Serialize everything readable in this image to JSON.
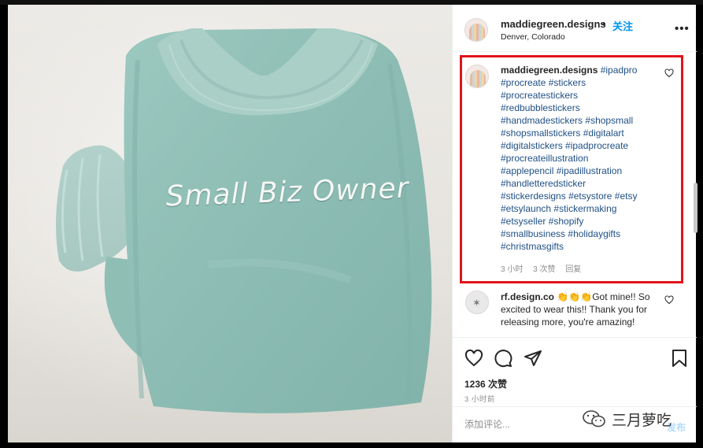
{
  "post": {
    "image_text": "Small Biz Owner",
    "colors": {
      "sweater": "#8fbeb5",
      "highlight_border": "#e1131b",
      "link": "#1f4f85",
      "follow": "#0095f6"
    }
  },
  "header": {
    "username": "maddiegreen.designs",
    "dot": "•",
    "follow_label": "关注",
    "location": "Denver, Colorado",
    "more_icon": "more-horizontal-icon"
  },
  "caption": {
    "username": "maddiegreen.designs",
    "hashtags": [
      "#ipadpro",
      "#procreate",
      "#stickers",
      "#procreatestickers",
      "#redbubblestickers",
      "#handmadestickers",
      "#shopsmall",
      "#shopsmallstickers",
      "#digitalart",
      "#digitalstickers",
      "#ipadprocreate",
      "#procreateillustration",
      "#applepencil",
      "#ipadillustration",
      "#handletteredsticker",
      "#stickerdesigns",
      "#etsystore",
      "#etsy",
      "#etsylaunch",
      "#stickermaking",
      "#etsyseller",
      "#shopify",
      "#smallbusiness",
      "#holidaygifts",
      "#christmasgifts"
    ],
    "meta": {
      "time": "3 小时",
      "likes": "3 次赞",
      "reply": "回复"
    }
  },
  "comment2": {
    "username": "rf.design.co",
    "emoji": "👏👏👏",
    "text": "Got mine!! So excited to wear this!! Thank you for releasing more, you're amazing!"
  },
  "actions": {
    "likes": "1236 次赞",
    "time_ago": "3 小时前"
  },
  "add_comment": {
    "placeholder": "添加评论...",
    "post_label": "发布"
  },
  "watermark": {
    "text": "三月萝吃"
  }
}
